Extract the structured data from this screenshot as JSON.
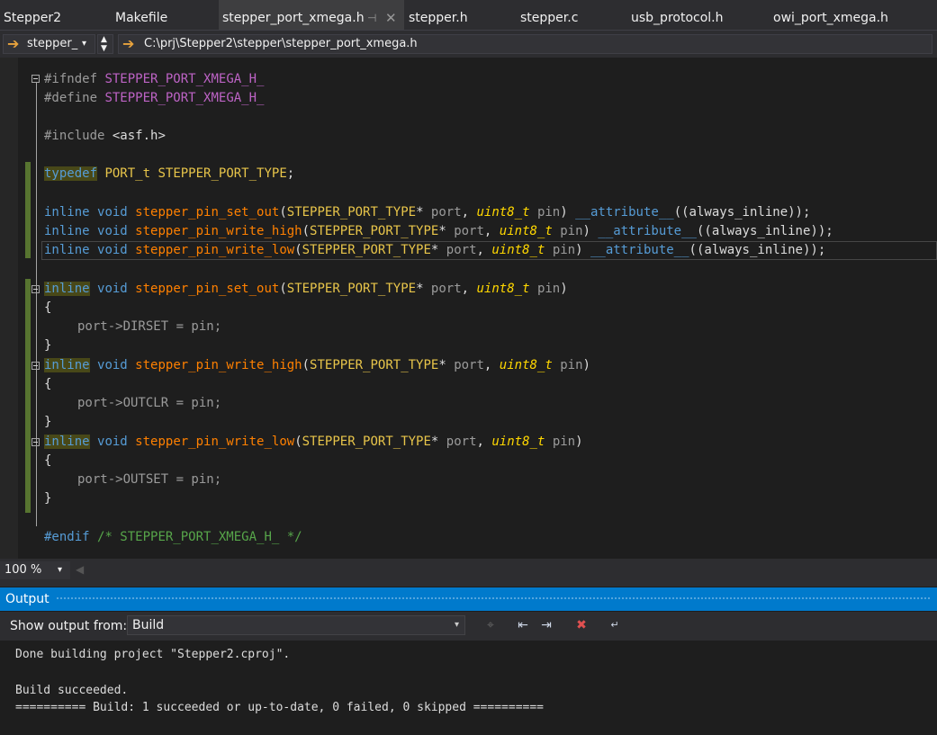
{
  "tabs": [
    {
      "label": "Stepper2"
    },
    {
      "label": "Makefile"
    },
    {
      "label": "stepper_port_xmega.h",
      "active": true
    },
    {
      "label": "stepper.h"
    },
    {
      "label": "stepper.c"
    },
    {
      "label": "usb_protocol.h"
    },
    {
      "label": "owi_port_xmega.h"
    }
  ],
  "nav": {
    "project": "stepper_",
    "path": "C:\\prj\\Stepper2\\stepper\\stepper_port_xmega.h"
  },
  "code": {
    "l1_pp": "#ifndef",
    "l1_mac": "STEPPER_PORT_XMEGA_H_",
    "l2_pp": "#define",
    "l2_mac": "STEPPER_PORT_XMEGA_H_",
    "l3_pp": "#include",
    "l3_inc": "<asf.h>",
    "typedef": "typedef",
    "port_t": "PORT_t",
    "port_type": "STEPPER_PORT_TYPE",
    "inline": "inline",
    "void": "void",
    "fn_set_out": "stepper_pin_set_out",
    "fn_write_high": "stepper_pin_write_high",
    "fn_write_low": "stepper_pin_write_low",
    "param_port": "port",
    "uint8": "uint8_t",
    "param_pin": "pin",
    "attr": "__attribute__",
    "always_inline": "always_inline",
    "body1": "port->DIRSET = pin;",
    "body2": "port->OUTCLR = pin;",
    "body3": "port->OUTSET = pin;",
    "endif_pp": "#endif",
    "endif_cm": "/* STEPPER_PORT_XMEGA_H_ */"
  },
  "zoom": "100 %",
  "output": {
    "title": "Output",
    "show_from_label": "Show output from:",
    "source": "Build",
    "lines": [
      "Done building project \"Stepper2.cproj\".",
      "",
      "Build succeeded.",
      "========== Build: 1 succeeded or up-to-date, 0 failed, 0 skipped =========="
    ]
  },
  "icons": {
    "nav_arrow": "arrow-right-icon",
    "accent": "#007acc"
  }
}
